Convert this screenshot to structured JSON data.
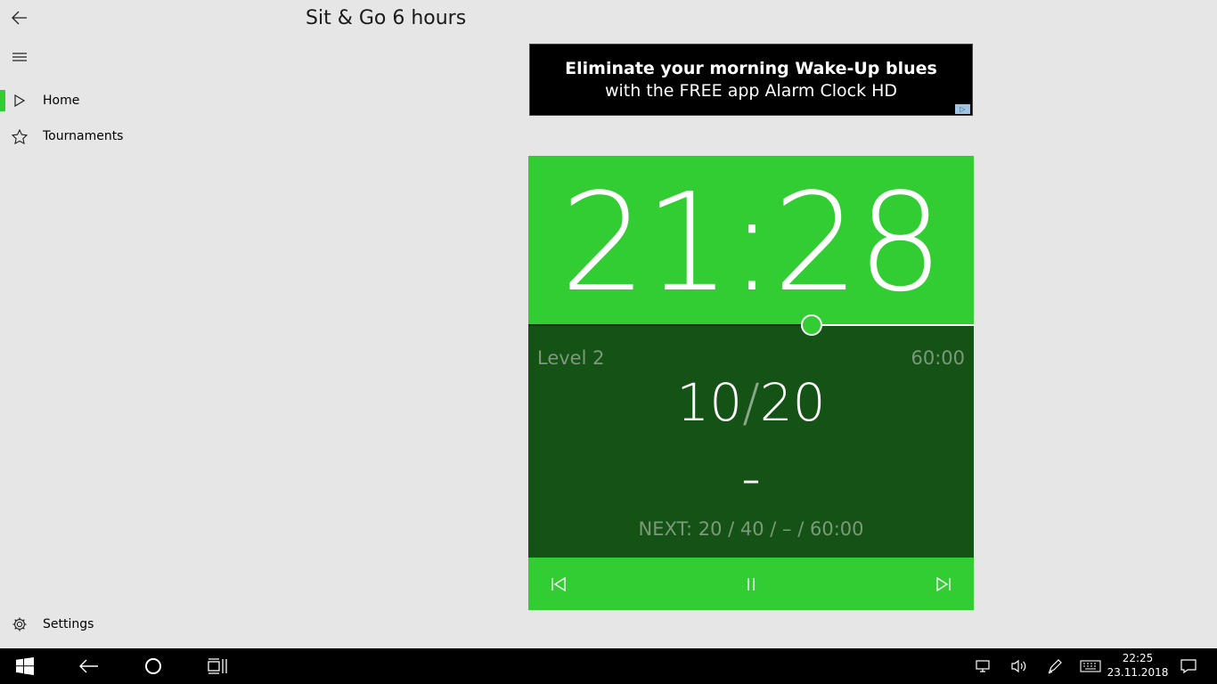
{
  "app": {
    "title": "Sit & Go 6 hours"
  },
  "nav": {
    "items": [
      {
        "label": "Home",
        "icon": "play-outline-icon",
        "active": true
      },
      {
        "label": "Tournaments",
        "icon": "star-outline-icon",
        "active": false
      }
    ],
    "settings_label": "Settings"
  },
  "ad": {
    "line1": "Eliminate your morning Wake-Up blues",
    "line2": "with the FREE app Alarm Clock HD"
  },
  "timer": {
    "clock": "21:28",
    "level_label": "Level 2",
    "level_duration": "60:00",
    "small_blind": "10",
    "big_blind": "20",
    "blind_separator": "/",
    "ante": "–",
    "next": "NEXT: 20 / 40 / – / 60:00",
    "progress": 0.636,
    "accent_color": "#32cd32",
    "panel_dark_color": "#155215"
  },
  "taskbar": {
    "time": "22:25",
    "date": "23.11.2018"
  }
}
